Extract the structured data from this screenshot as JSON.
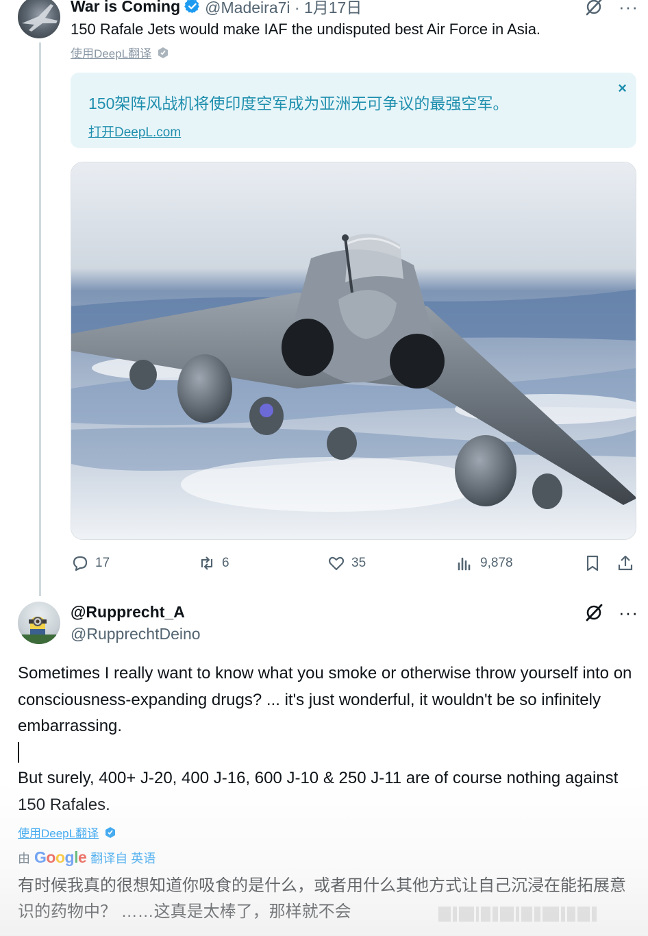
{
  "tweet1": {
    "name": "War is Coming",
    "handle": "@Madeira7i · 1月17日",
    "text": "150 Rafale Jets would make IAF the undisputed best Air Force in Asia.",
    "translate_link": "使用DeepL翻译",
    "translation": {
      "text": "150架阵风战机将使印度空军成为亚洲无可争议的最强空军。",
      "link": "打开DeepL.com",
      "close": "×"
    },
    "actions": {
      "replies": "17",
      "reposts": "6",
      "likes": "35",
      "views": "9,878"
    }
  },
  "tweet2": {
    "name": "@Rupprecht_A",
    "handle": "@RupprechtDeino",
    "paragraph1": "Sometimes I really want to know what you smoke or otherwise throw yourself into on consciousness-expanding drugs? ... it's just wonderful, it wouldn't be so infinitely embarrassing.",
    "paragraph2": "But surely, 400+ J-20, 400 J-16, 600 J-10 & 250 J-11 are of course nothing against 150 Rafales.",
    "translate_link": "使用DeepL翻译",
    "google_prefix": "由",
    "google_suffix": "翻译自 英语",
    "translation": "有时候我真的很想知道你吸食的是什么，或者用什么其他方式让自己沉浸在能拓展意识的药物中？ ……这真是太棒了，那样就不会"
  },
  "colors": {
    "translate_blue": "#1f8fae",
    "translate_bg": "#e8f5f8",
    "link_blue": "#1d9bf0",
    "muted": "#536471"
  },
  "icons": [
    "verified-badge-icon",
    "grok-icon",
    "more-icon",
    "reply-icon",
    "repost-icon",
    "like-icon",
    "views-icon",
    "bookmark-icon",
    "share-icon",
    "deepl-shield-icon",
    "close-icon"
  ]
}
